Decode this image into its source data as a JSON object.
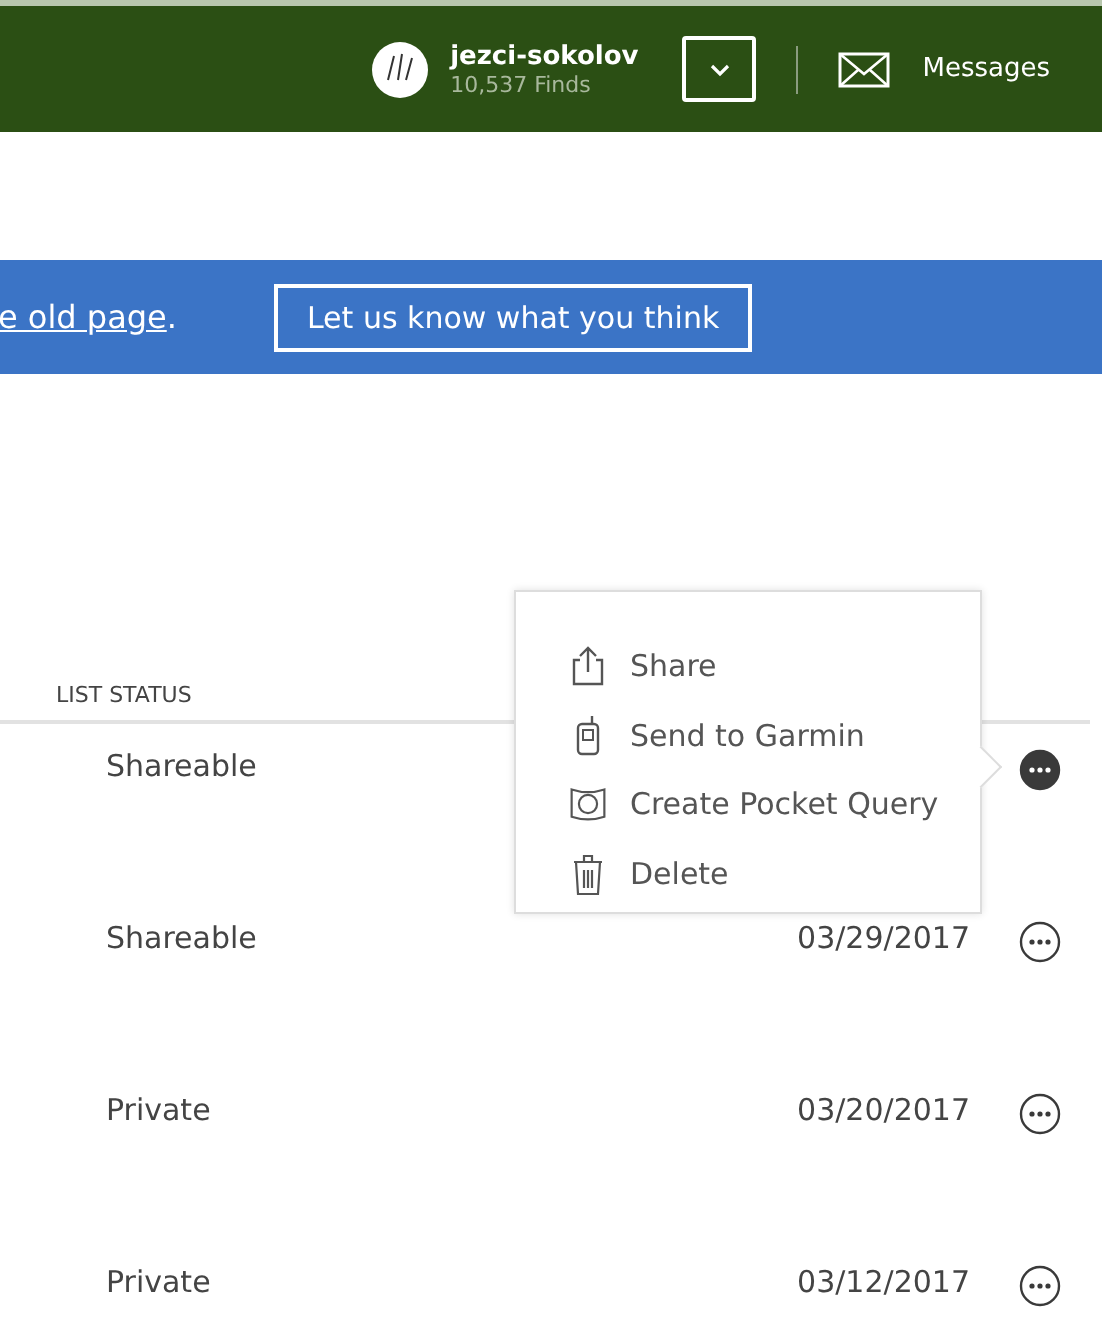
{
  "header": {
    "username": "jezci-sokolov",
    "finds": "10,537 Finds",
    "messages": "Messages"
  },
  "banner": {
    "link": "e old page",
    "after": ".",
    "button": "Let us know what you think"
  },
  "table": {
    "columns": [
      "LIST STATUS"
    ],
    "rows": [
      {
        "status": "Shareable",
        "date": "",
        "menu_open": true
      },
      {
        "status": "Shareable",
        "date": "03/29/2017",
        "menu_open": false
      },
      {
        "status": "Private",
        "date": "03/20/2017",
        "menu_open": false
      },
      {
        "status": "Private",
        "date": "03/12/2017",
        "menu_open": false
      }
    ]
  },
  "menu": {
    "items": [
      {
        "kind": "share",
        "label": "Share"
      },
      {
        "kind": "garmin",
        "label": "Send to Garmin"
      },
      {
        "kind": "query",
        "label": "Create Pocket Query"
      },
      {
        "kind": "delete",
        "label": "Delete"
      }
    ]
  }
}
